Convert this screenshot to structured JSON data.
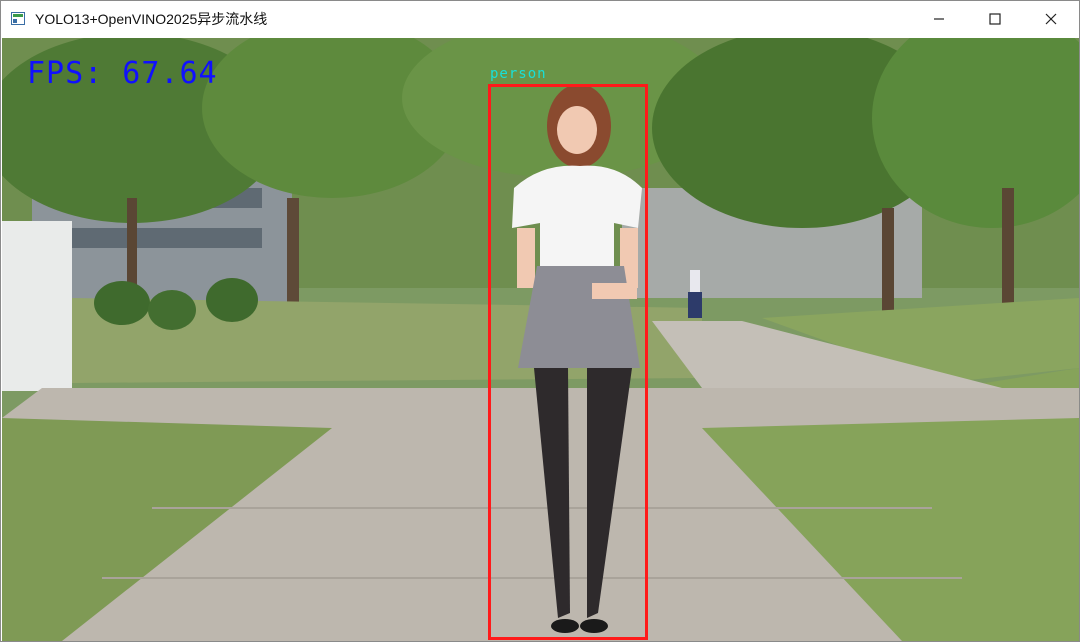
{
  "window": {
    "title": "YOLO13+OpenVINO2025异步流水线",
    "app_icon": "window-app-icon",
    "controls": [
      "minimize-icon",
      "maximize-icon",
      "close-icon"
    ]
  },
  "overlay": {
    "fps_text": "FPS: 67.64",
    "fps_color": "#1010ff"
  },
  "detections": [
    {
      "label": "person",
      "box_color": "#ff1a1a",
      "label_color": "#18e0d8"
    }
  ]
}
